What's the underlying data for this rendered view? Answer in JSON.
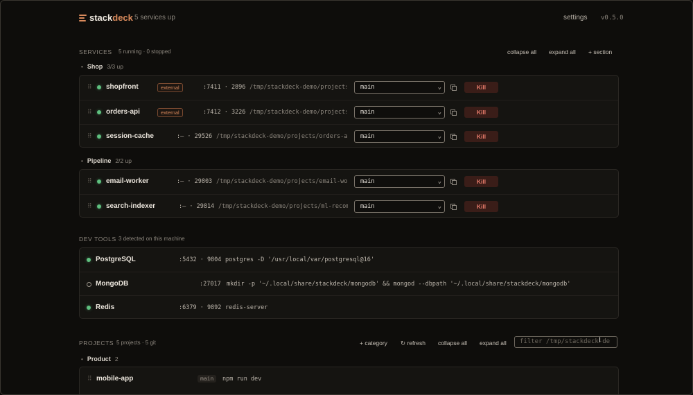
{
  "app": {
    "brand_a": "stack",
    "brand_b": "deck",
    "status": "5 services up",
    "settings": "settings",
    "version": "v0.5.0",
    "accent_color": "#d98a5c",
    "up_color": "#5fc07f",
    "kill_color": "#e77b6b"
  },
  "services": {
    "title": "SERVICES",
    "summary": "5 running · 0 stopped",
    "actions": {
      "collapse": "collapse all",
      "expand": "expand all",
      "add": "+ section"
    },
    "categories": [
      {
        "name": "Shop",
        "count": "3/3 up",
        "rows": [
          {
            "name": "shopfront",
            "badge": "external",
            "meta": ":7411 · 2896",
            "path": "/tmp/stackdeck-demo/projects/shopfront",
            "branch": "main",
            "kill": "Kill"
          },
          {
            "name": "orders-api",
            "badge": "external",
            "meta": ":7412 · 3226",
            "path": "/tmp/stackdeck-demo/projects/orders-api",
            "branch": "main",
            "kill": "Kill"
          },
          {
            "name": "session-cache",
            "badge": "",
            "meta": ":— · 29526",
            "path": "/tmp/stackdeck-demo/projects/orders-api",
            "branch": "main",
            "kill": "Kill"
          }
        ]
      },
      {
        "name": "Pipeline",
        "count": "2/2 up",
        "rows": [
          {
            "name": "email-worker",
            "badge": "",
            "meta": ":— · 29803",
            "path": "/tmp/stackdeck-demo/projects/email-worker",
            "branch": "main",
            "kill": "Kill"
          },
          {
            "name": "search-indexer",
            "badge": "",
            "meta": ":— · 29814",
            "path": "/tmp/stackdeck-demo/projects/ml-recommender",
            "branch": "main",
            "kill": "Kill"
          }
        ]
      }
    ]
  },
  "devtools": {
    "title": "DEV TOOLS",
    "summary": "3 detected on this machine",
    "rows": [
      {
        "name": "PostgreSQL",
        "meta": ":5432 · 9804",
        "command": "postgres -D '/usr/local/var/postgresql@16'",
        "running": true
      },
      {
        "name": "MongoDB",
        "meta": ":27017",
        "command": "mkdir -p '~/.local/share/stackdeck/mongodb' && mongod --dbpath '~/.local/share/stackdeck/mongodb'",
        "running": false
      },
      {
        "name": "Redis",
        "meta": ":6379 · 9892",
        "command": "redis-server",
        "running": true
      }
    ]
  },
  "projects": {
    "title": "PROJECTS",
    "summary": "5 projects · 5 git",
    "actions": {
      "category": "+ category",
      "refresh": "↻ refresh",
      "collapse": "collapse all",
      "expand": "expand all"
    },
    "filter_placeholder": "filter /tmp/stackdeck-de",
    "categories": [
      {
        "name": "Product",
        "count": "2",
        "rows": [
          {
            "name": "mobile-app",
            "branch": "main",
            "command": "npm run dev"
          }
        ]
      }
    ]
  }
}
